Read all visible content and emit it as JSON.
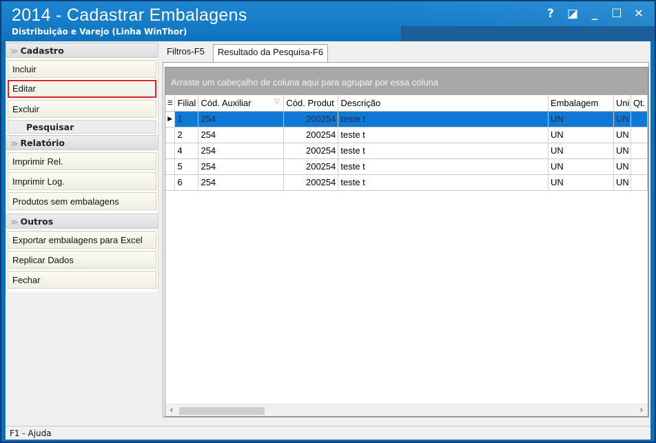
{
  "window": {
    "title": "2014 - Cadastrar Embalagens",
    "subtitle": "Distribuição e Varejo (Linha WinThor)",
    "buttons": {
      "help": "?",
      "restore": "◪",
      "minimize": "_",
      "maximize": "☐",
      "close": "✕"
    }
  },
  "sidebar": {
    "cadastro": {
      "header": "Cadastro",
      "items": [
        "Incluir",
        "Editar",
        "Excluir"
      ],
      "subheader": "Pesquisar"
    },
    "relatorio": {
      "header": "Relatório",
      "items": [
        "Imprimir Rel.",
        "Imprimir Log.",
        "Produtos sem embalagens"
      ]
    },
    "outros": {
      "header": "Outros",
      "items": [
        "Exportar embalagens para Excel",
        "Replicar Dados",
        "Fechar"
      ]
    }
  },
  "tabs": [
    {
      "label": "Filtros-F5",
      "active": false
    },
    {
      "label": "Resultado da Pesquisa-F6",
      "active": true
    }
  ],
  "grid": {
    "group_panel_text": "Arraste um cabeçalho de coluna aqui para agrupar por essa coluna",
    "columns": [
      "Filial",
      "Cód. Auxiliar",
      "Cód. Produt",
      "Descrição",
      "Embalagem",
      "Uni",
      "Qt."
    ],
    "rows": [
      [
        "1",
        "254",
        "200254",
        "teste t",
        "UN",
        "UN",
        ""
      ],
      [
        "2",
        "254",
        "200254",
        "teste t",
        "UN",
        "UN",
        ""
      ],
      [
        "4",
        "254",
        "200254",
        "teste t",
        "UN",
        "UN",
        ""
      ],
      [
        "5",
        "254",
        "200254",
        "teste t",
        "UN",
        "UN",
        ""
      ],
      [
        "6",
        "254",
        "200254",
        "teste t",
        "UN",
        "UN",
        ""
      ]
    ],
    "selected_row": 0,
    "selection_color": "#0e78d4"
  },
  "status": {
    "text": "F1 - Ajuda"
  },
  "colors": {
    "title_bar": "#0f74bf",
    "highlight_border": "#d9262c"
  }
}
